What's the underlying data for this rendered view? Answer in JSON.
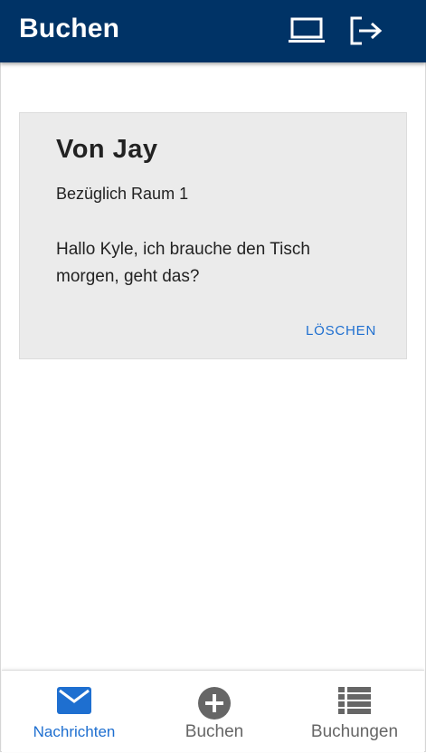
{
  "header": {
    "title": "Buchen",
    "icons": [
      "laptop-icon",
      "logout-icon"
    ]
  },
  "message": {
    "from": "Von Jay",
    "subject": "Bezüglich Raum 1",
    "body": "Hallo Kyle, ich brauche den Tisch morgen, geht das?",
    "delete_label": "LÖSCHEN"
  },
  "bottom_nav": {
    "items": [
      {
        "label": "Nachrichten",
        "icon": "mail-icon",
        "active": true
      },
      {
        "label": "Buchen",
        "icon": "add-circle-icon",
        "active": false
      },
      {
        "label": "Buchungen",
        "icon": "list-icon",
        "active": false
      }
    ]
  },
  "colors": {
    "appbar": "#003366",
    "accent": "#1e6fd0",
    "card_bg": "#ebebeb",
    "inactive": "#666666"
  }
}
